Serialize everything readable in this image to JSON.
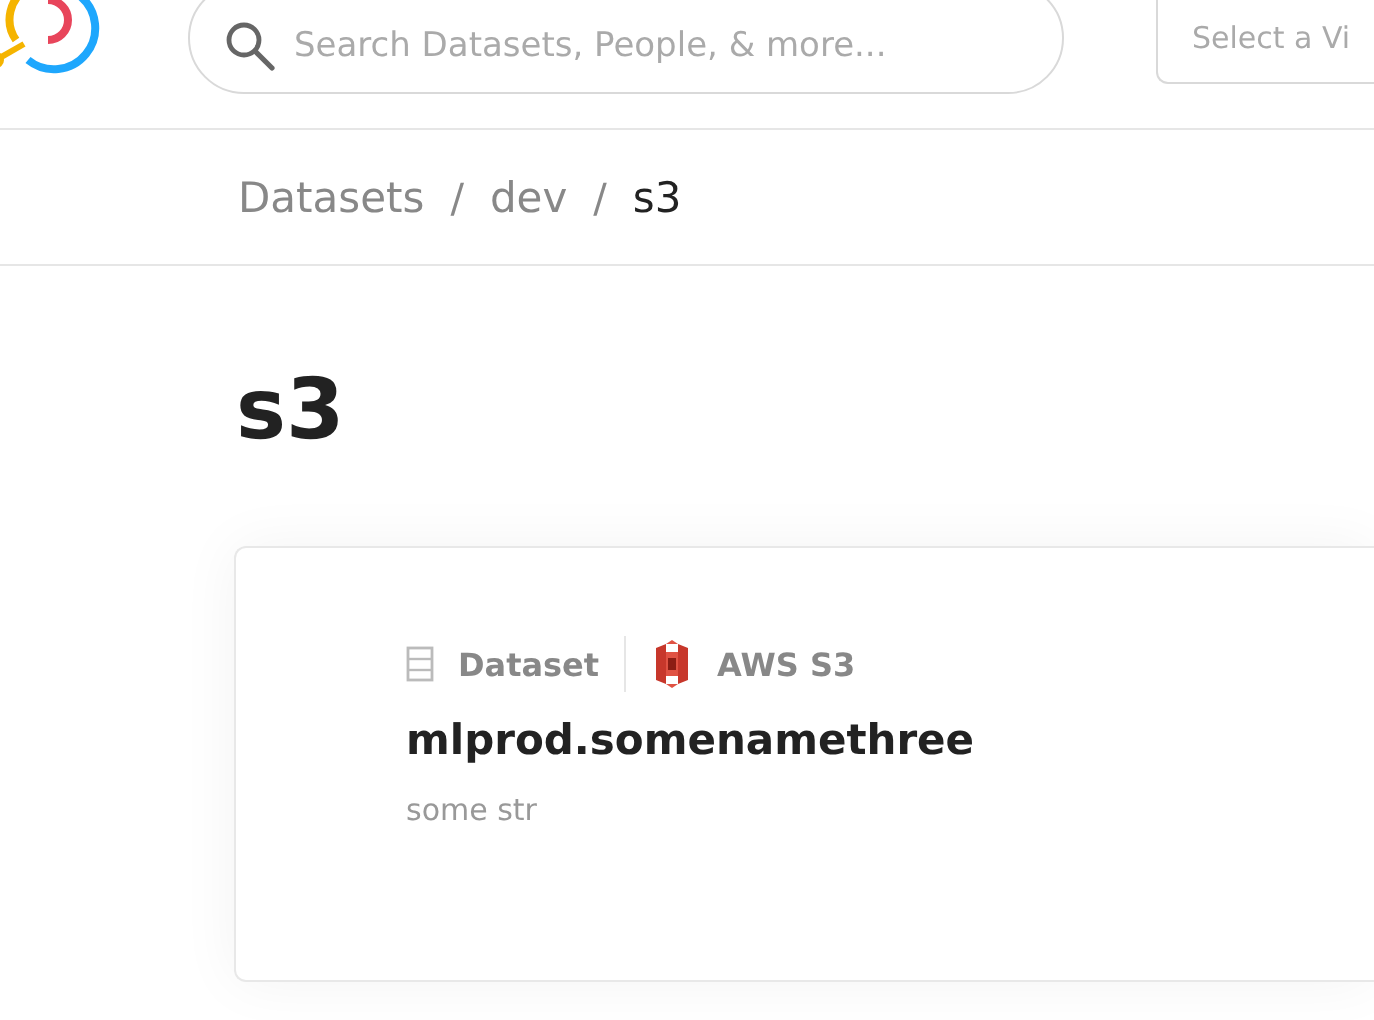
{
  "search": {
    "placeholder": "Search Datasets, People, & more..."
  },
  "view_select": {
    "placeholder": "Select a Vi"
  },
  "breadcrumbs": [
    {
      "label": "Datasets",
      "current": false
    },
    {
      "label": "dev",
      "current": false
    },
    {
      "label": "s3",
      "current": true
    }
  ],
  "separator": "/",
  "page_title": "s3",
  "card": {
    "type_label": "Dataset",
    "platform": "AWS S3",
    "name": "mlprod.somenamethree",
    "description": "some str"
  }
}
